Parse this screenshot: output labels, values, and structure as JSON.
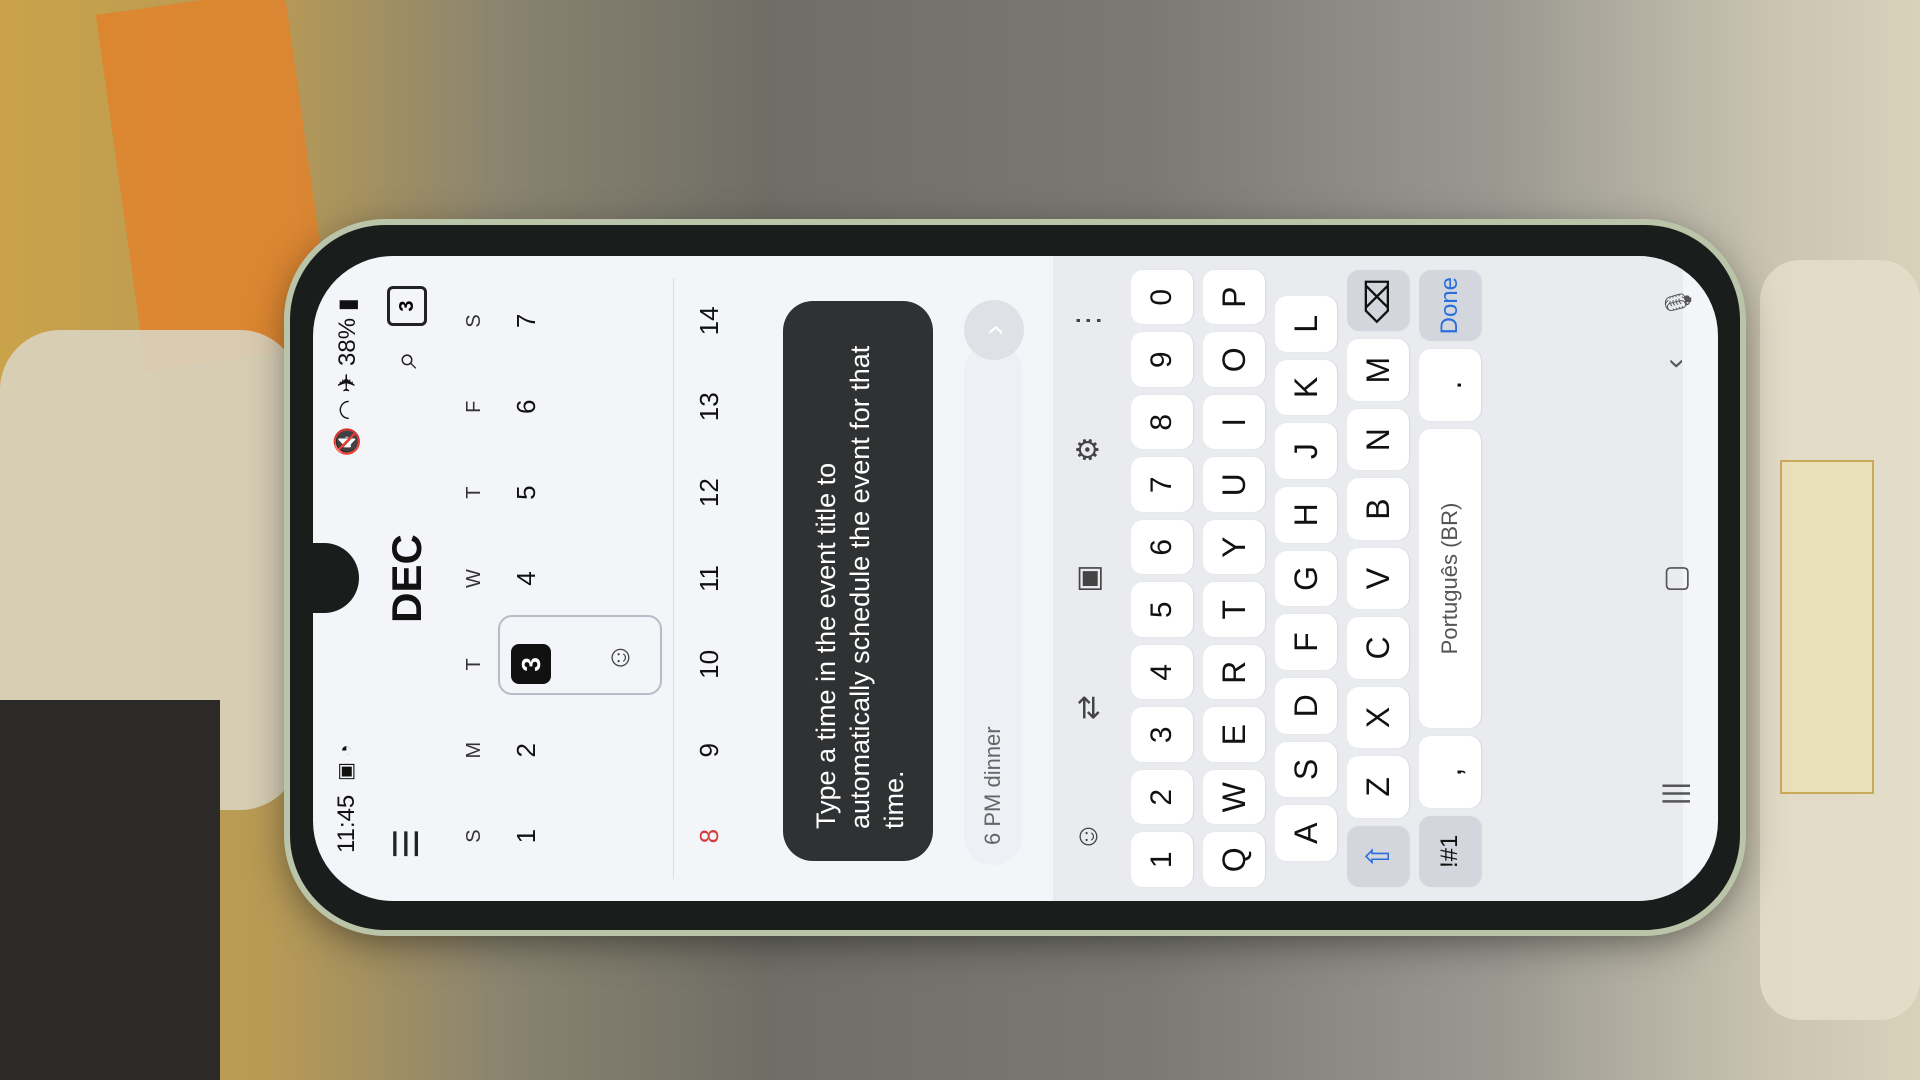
{
  "status": {
    "time": "11:45",
    "battery": "38%"
  },
  "header": {
    "month": "DEC",
    "today_num": "3"
  },
  "calendar": {
    "weekdays": [
      "S",
      "M",
      "T",
      "W",
      "T",
      "F",
      "S"
    ],
    "week1": [
      "1",
      "2",
      "3",
      "4",
      "5",
      "6",
      "7"
    ],
    "week2": [
      "8",
      "9",
      "10",
      "11",
      "12",
      "13",
      "14"
    ]
  },
  "tooltip": {
    "text": "Type a time in the event title to automatically schedule the event for that time."
  },
  "input": {
    "value": "6 PM dinner"
  },
  "keyboard": {
    "row_num": [
      "1",
      "2",
      "3",
      "4",
      "5",
      "6",
      "7",
      "8",
      "9",
      "0"
    ],
    "row_q": [
      "Q",
      "W",
      "E",
      "R",
      "T",
      "Y",
      "U",
      "I",
      "O",
      "P"
    ],
    "row_a": [
      "A",
      "S",
      "D",
      "F",
      "G",
      "H",
      "J",
      "K",
      "L"
    ],
    "row_z": [
      "Z",
      "X",
      "C",
      "V",
      "B",
      "N",
      "M"
    ],
    "sym_label": "!#1",
    "comma": ",",
    "space_label": "Português (BR)",
    "period": ".",
    "done_label": "Done"
  }
}
